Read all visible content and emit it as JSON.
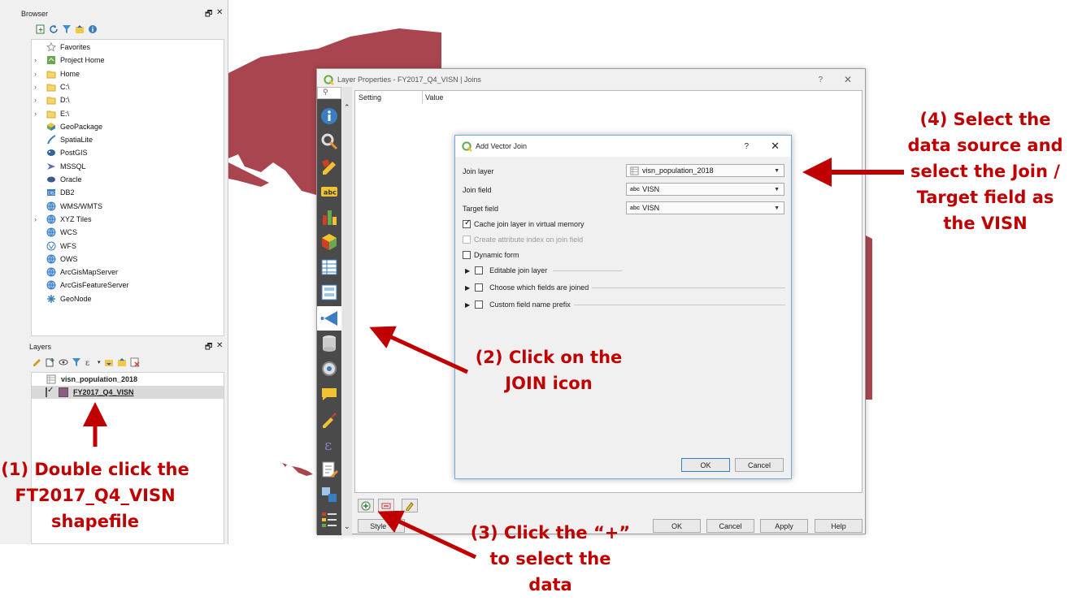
{
  "browser": {
    "title": "Browser",
    "items": [
      {
        "label": "Favorites",
        "icon": "star-icon",
        "arrow": ""
      },
      {
        "label": "Project Home",
        "icon": "project-home-icon",
        "arrow": "›"
      },
      {
        "label": "Home",
        "icon": "folder-icon",
        "arrow": "›"
      },
      {
        "label": "C:\\",
        "icon": "folder-icon",
        "arrow": "›"
      },
      {
        "label": "D:\\",
        "icon": "folder-icon",
        "arrow": "›"
      },
      {
        "label": "E:\\",
        "icon": "folder-icon",
        "arrow": "›"
      },
      {
        "label": "GeoPackage",
        "icon": "geopackage-icon",
        "arrow": ""
      },
      {
        "label": "SpatiaLite",
        "icon": "spatialite-icon",
        "arrow": ""
      },
      {
        "label": "PostGIS",
        "icon": "postgis-icon",
        "arrow": ""
      },
      {
        "label": "MSSQL",
        "icon": "mssql-icon",
        "arrow": ""
      },
      {
        "label": "Oracle",
        "icon": "oracle-icon",
        "arrow": ""
      },
      {
        "label": "DB2",
        "icon": "db2-icon",
        "arrow": ""
      },
      {
        "label": "WMS/WMTS",
        "icon": "globe-icon",
        "arrow": ""
      },
      {
        "label": "XYZ Tiles",
        "icon": "globe-icon",
        "arrow": "›"
      },
      {
        "label": "WCS",
        "icon": "globe-icon",
        "arrow": ""
      },
      {
        "label": "WFS",
        "icon": "wfs-icon",
        "arrow": ""
      },
      {
        "label": "OWS",
        "icon": "globe-icon",
        "arrow": ""
      },
      {
        "label": "ArcGisMapServer",
        "icon": "globe-icon",
        "arrow": ""
      },
      {
        "label": "ArcGisFeatureServer",
        "icon": "globe-icon",
        "arrow": ""
      },
      {
        "label": "GeoNode",
        "icon": "geonode-icon",
        "arrow": ""
      }
    ]
  },
  "layers": {
    "title": "Layers",
    "items": [
      {
        "label": "visn_population_2018"
      },
      {
        "label": "FY2017_Q4_VISN"
      }
    ]
  },
  "layer_properties": {
    "title": "Layer Properties - FY2017_Q4_VISN | Joins",
    "help": "?",
    "close": "✕",
    "search_placeholder": "",
    "columns": [
      "Setting",
      "Value"
    ],
    "style_button": "Style",
    "ok": "OK",
    "cancel": "Cancel",
    "apply": "Apply",
    "help_button": "Help"
  },
  "add_vector_join": {
    "title": "Add Vector Join",
    "help": "?",
    "close": "✕",
    "join_layer_label": "Join layer",
    "join_layer_value": "visn_population_2018",
    "join_field_label": "Join field",
    "join_field_value": "VISN",
    "target_field_label": "Target field",
    "target_field_value": "VISN",
    "field_type": "abc",
    "cache_label": "Cache join layer in virtual memory",
    "cache_checked": true,
    "index_label": "Create attribute index on join field",
    "dynamic_form_label": "Dynamic form",
    "editable_label": "Editable join layer",
    "choose_fields_label": "Choose which fields are joined",
    "prefix_label": "Custom field name prefix",
    "ok": "OK",
    "cancel": "Cancel"
  },
  "annotations": {
    "step1": [
      "(1) Double click the",
      "FT2017_Q4_VISN",
      "shapefile"
    ],
    "step2": [
      "(2) Click on the",
      "JOIN icon"
    ],
    "step3": [
      "(3) Click the “+”",
      "to select the",
      "data"
    ],
    "step4": [
      "(4) Select the",
      "data source and",
      "select the Join /",
      "Target field as",
      "the VISN"
    ]
  },
  "colors": {
    "annotation": "#c00000",
    "map_fill": "#a8454e",
    "layer_swatch": "#8e5c80"
  }
}
